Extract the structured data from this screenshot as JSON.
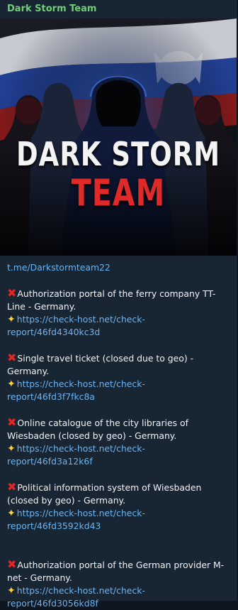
{
  "post": {
    "sender": "Dark Storm Team",
    "banner": {
      "title_line1": "DARK STORM",
      "title_line2": "TEAM"
    },
    "channel_link": "t.me/Darkstormteam22",
    "entries": [
      {
        "text": "Authorization portal of the ferry company TT-Line - Germany.",
        "link": "https://check-host.net/check-report/46fd4340kc3d"
      },
      {
        "text": "Single travel ticket (closed due to geo) - Germany.",
        "link": "https://check-host.net/check-report/46fd3f7fkc8a"
      },
      {
        "text": "Online catalogue of the city libraries of Wiesbaden (closed by geo) - Germany.",
        "link": "https://check-host.net/check-report/46fd3a12k6f"
      },
      {
        "text": "Political information system of Wiesbaden (closed by geo) - Germany.",
        "link": "https://check-host.net/check-report/46fd3592kd43"
      },
      {
        "text": "Authorization portal of the German provider M-net - Germany.",
        "link": "https://check-host.net/check-report/46fd3056kd8f"
      }
    ],
    "icons": {
      "entry_marker": "cross-mark-icon",
      "link_marker": "star-icon"
    },
    "colors": {
      "sender": "#6fcf73",
      "link": "#6ab3f3",
      "cross": "#e52521",
      "title_red": "#e02a2a"
    }
  }
}
